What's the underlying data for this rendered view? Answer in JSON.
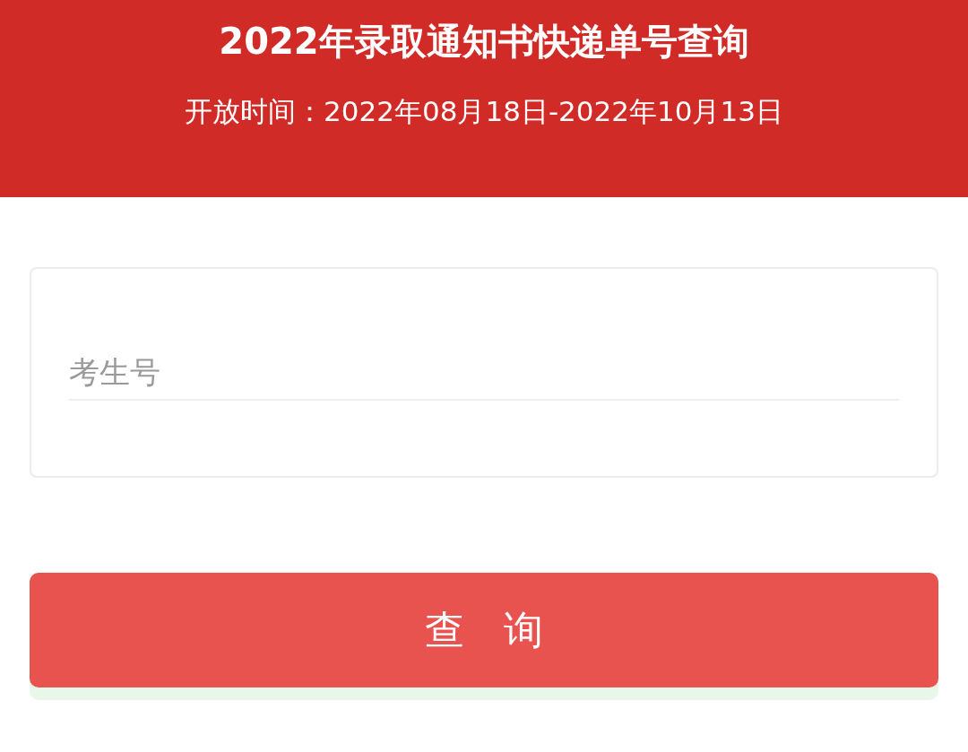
{
  "header": {
    "title": "2022年录取通知书快递单号查询",
    "subtitle": "开放时间：2022年08月18日-2022年10月13日"
  },
  "form": {
    "field": {
      "placeholder": "考生号"
    }
  },
  "button": {
    "label": "查　询"
  }
}
